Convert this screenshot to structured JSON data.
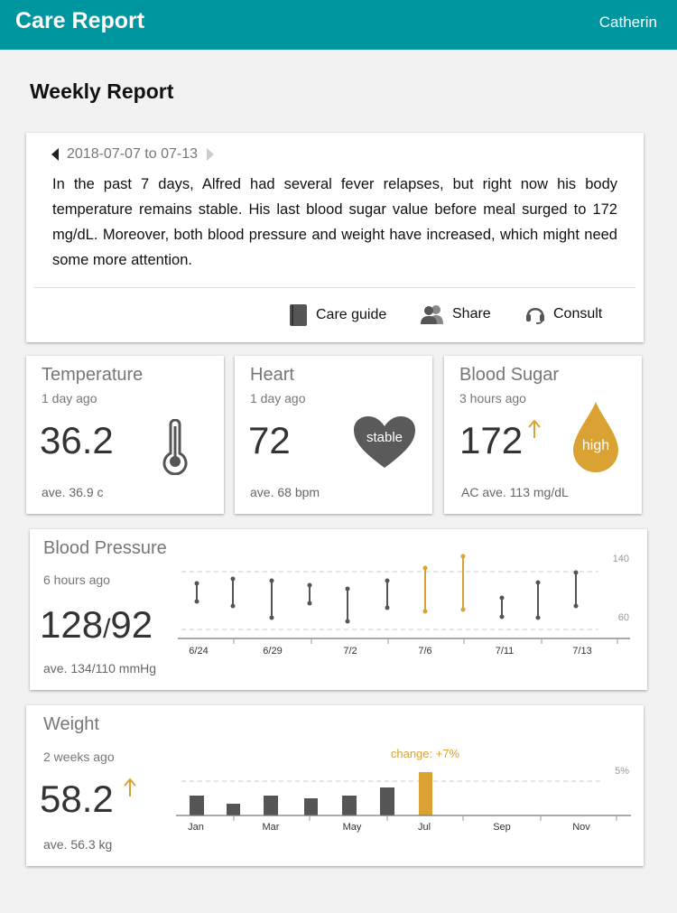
{
  "header": {
    "title": "Care Report",
    "user": "Catherin"
  },
  "page": {
    "title": "Weekly Report"
  },
  "summary": {
    "date_range": "2018-07-07 to 07-13",
    "text": "In the past 7 days, Alfred had several fever relapses, but right now his body temperature remains stable. His last blood sugar value  before meal surged to 172 mg/dL. Moreover, both blood pressure and weight have increased, which might need some more attention.",
    "actions": {
      "care_guide": "Care guide",
      "share": "Share",
      "consult": "Consult"
    }
  },
  "temperature": {
    "title": "Temperature",
    "time": "1 day ago",
    "value": "36.2",
    "ave": "ave. 36.9 c",
    "icon": "thermometer-icon"
  },
  "heart": {
    "title": "Heart",
    "time": "1 day ago",
    "value": "72",
    "ave": "ave. 68 bpm",
    "badge": "stable",
    "icon": "heart-icon"
  },
  "blood_sugar": {
    "title": "Blood Sugar",
    "time": "3 hours ago",
    "value": "172",
    "ave": "AC ave. 113 mg/dL",
    "badge": "high",
    "trend": "up",
    "icon": "drop-icon"
  },
  "blood_pressure": {
    "title": "Blood Pressure",
    "time": "6 hours ago",
    "value_sys": "128",
    "value_sep": "/",
    "value_dia": "92",
    "ave": "ave. 134/110 mmHg",
    "x_labels": [
      "6/24",
      "6/29",
      "7/2",
      "7/6",
      "7/11",
      "7/13"
    ],
    "ref_labels": [
      "140",
      "60"
    ]
  },
  "weight": {
    "title": "Weight",
    "time": "2 weeks ago",
    "value": "58.2",
    "trend": "up",
    "ave": "ave. 56.3 kg",
    "change_label": "change: +7%",
    "ref_label": "5%",
    "x_labels": [
      "Jan",
      "Mar",
      "May",
      "Jul",
      "Sep",
      "Nov"
    ]
  },
  "colors": {
    "header": "#0096a0",
    "accent": "#d9a232",
    "dark": "#555555",
    "muted": "#777777"
  }
}
